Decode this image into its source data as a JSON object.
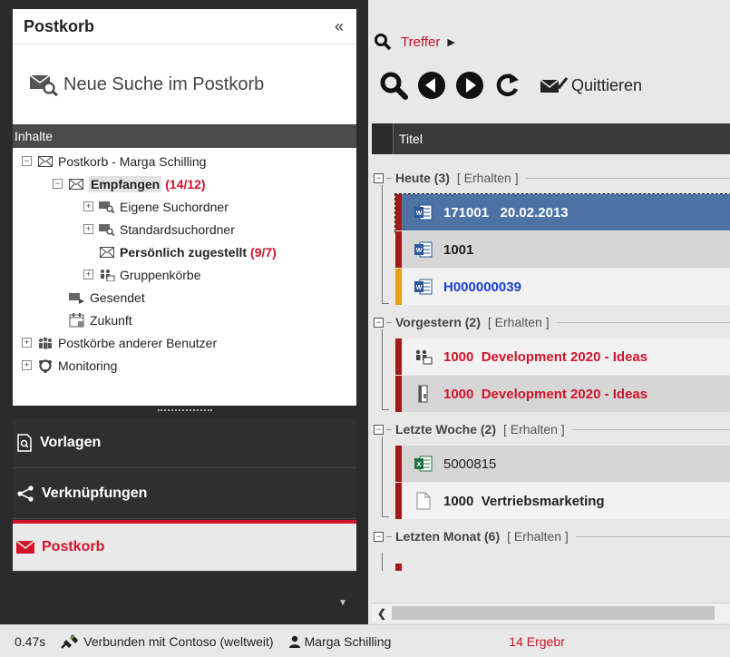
{
  "colors": {
    "accent": "#d0142c",
    "selected_row": "#4d73a5",
    "dark_bar": "#a31919",
    "amber_bar": "#e3a21a"
  },
  "left": {
    "title": "Postkorb",
    "collapse_glyph": "«",
    "new_search_label": "Neue Suche im Postkorb",
    "section_label": "Inhalte",
    "tree": {
      "root_label": "Postkorb - Marga Schilling",
      "received_label": "Empfangen",
      "received_count": "(14/12)",
      "own_search_label": "Eigene Suchordner",
      "std_search_label": "Standardsuchordner",
      "personal_label": "Persönlich zugestellt",
      "personal_count": "(9/7)",
      "group_label": "Gruppenkörbe",
      "sent_label": "Gesendet",
      "future_label": "Zukunft",
      "others_label": "Postkörbe anderer Benutzer",
      "monitoring_label": "Monitoring"
    },
    "nav": {
      "vorlagen": "Vorlagen",
      "verknuepfungen": "Verknüpfungen",
      "postkorb": "Postkorb"
    }
  },
  "right": {
    "breadcrumb": "Treffer",
    "toolbar": {
      "quittieren_label": "Quittieren"
    },
    "column_title": "Titel",
    "groups": [
      {
        "title": "Heute (3)",
        "sub": "[ Erhalten ]"
      },
      {
        "title": "Vorgestern (2)",
        "sub": "[ Erhalten ]"
      },
      {
        "title": "Letzte Woche (2)",
        "sub": "[ Erhalten ]"
      },
      {
        "title": "Letzten Monat (6)",
        "sub": "[ Erhalten ]"
      }
    ],
    "rows": [
      {
        "text": "171001   20.02.2013",
        "icon": "word-icon"
      },
      {
        "text": "1001",
        "icon": "word-icon"
      },
      {
        "text": "H000000039",
        "icon": "word-icon"
      },
      {
        "text": "1000  Development 2020 - Ideas",
        "icon": "group-inbox-icon"
      },
      {
        "text": "1000  Development 2020 - Ideas",
        "icon": "file-binder-icon"
      },
      {
        "text": "5000815",
        "icon": "excel-icon"
      },
      {
        "text": "1000  Vertriebsmarketing",
        "icon": "blank-document-icon"
      }
    ]
  },
  "status": {
    "time": "0.47s",
    "connection": "Verbunden mit Contoso (weltweit)",
    "user": "Marga Schilling",
    "results": "14 Ergebr"
  }
}
